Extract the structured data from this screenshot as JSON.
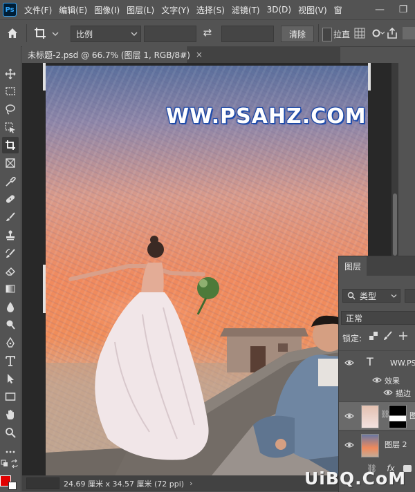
{
  "app": {
    "logo_text": "Ps"
  },
  "menubar": {
    "items": [
      "文件(F)",
      "编辑(E)",
      "图像(I)",
      "图层(L)",
      "文字(Y)",
      "选择(S)",
      "滤镜(T)",
      "3D(D)",
      "视图(V)",
      "窗"
    ]
  },
  "window_controls": {
    "minimize": "—",
    "restore": "❐"
  },
  "options": {
    "ratio_label": "比例",
    "swap_icon": "⇄",
    "clear_label": "清除",
    "straighten_label": "拉直"
  },
  "document": {
    "tab_title": "未标题-2.psd @ 66.7% (图层 1, RGB/8#)",
    "close_glyph": "×",
    "watermark": "WW.PSAHZ.COM",
    "size_info": "24.69 厘米 x 34.57 厘米 (72 ppi)",
    "status_arrow": "›"
  },
  "layers_panel": {
    "tab_label": "图层",
    "filter_label": "类型",
    "blend_mode": "正常",
    "lock_label": "锁定:",
    "layers": [
      {
        "name": "WW.PS",
        "kind": "text"
      },
      {
        "name": "效果",
        "kind": "effects"
      },
      {
        "name": "描边",
        "kind": "effect"
      },
      {
        "name": "图",
        "kind": "masked"
      },
      {
        "name": "图层 2",
        "kind": "image"
      }
    ],
    "footer_fx": "fx"
  },
  "site_watermark": "UiBQ.CoM",
  "colors": {
    "foreground": "#e00000",
    "background": "#ffffff",
    "ps_accent": "#31a8ff"
  },
  "icons": [
    "home-icon",
    "crop-icon",
    "swap-icon",
    "move-tool-icon",
    "marquee-tool-icon",
    "lasso-tool-icon",
    "object-select-icon",
    "crop-tool-icon",
    "frame-tool-icon",
    "eyedropper-icon",
    "healing-brush-icon",
    "brush-icon",
    "stamp-icon",
    "history-brush-icon",
    "eraser-icon",
    "gradient-icon",
    "blur-icon",
    "dodge-icon",
    "pen-icon",
    "type-icon",
    "path-select-icon",
    "rectangle-icon",
    "hand-icon",
    "zoom-icon",
    "more-tools-icon",
    "eye-icon",
    "link-icon",
    "fx-icon"
  ]
}
